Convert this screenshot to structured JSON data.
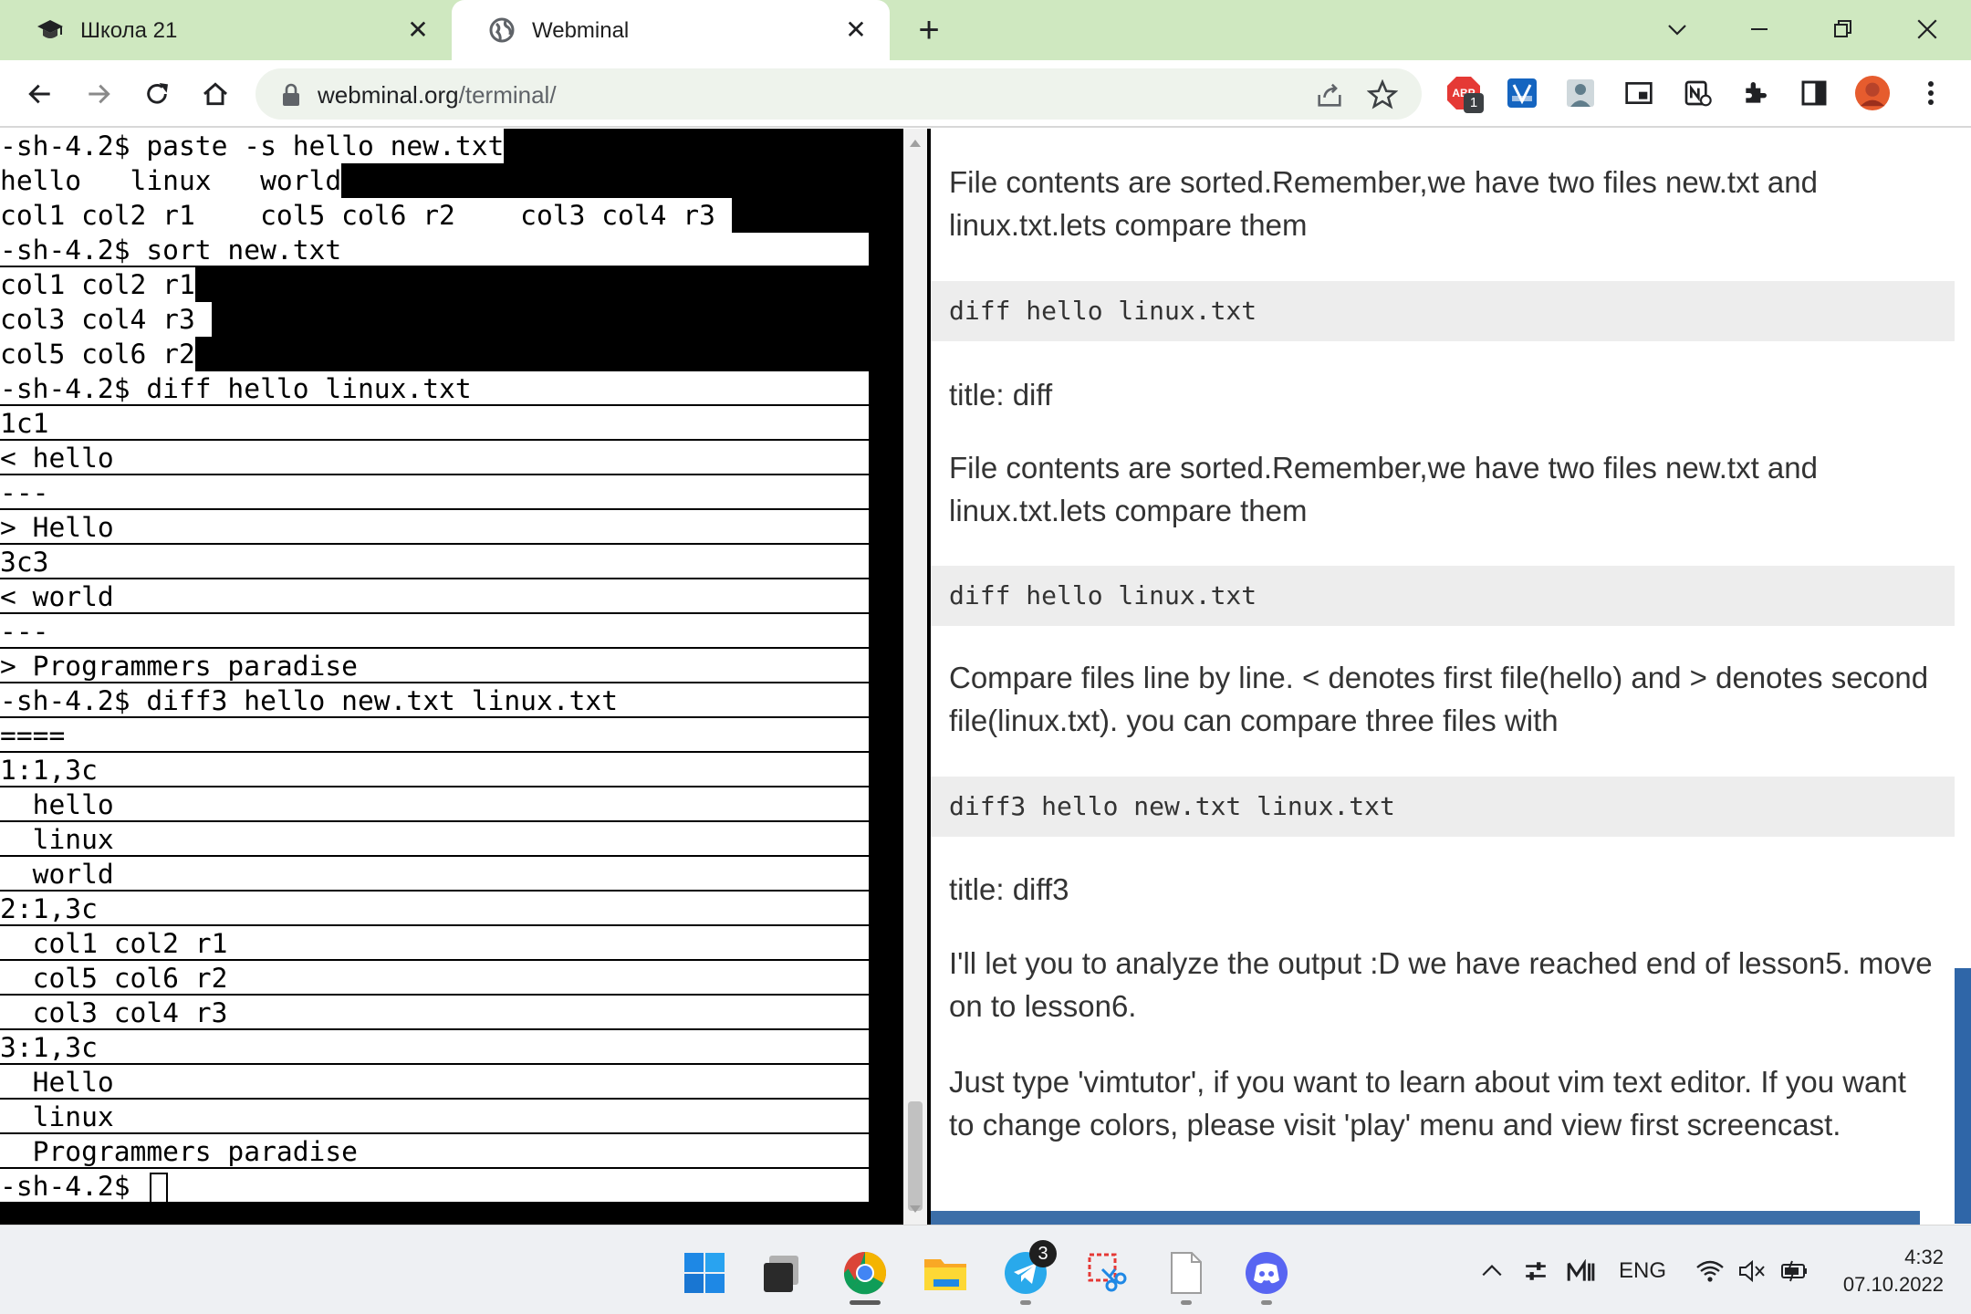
{
  "browser": {
    "tabs": [
      {
        "title": "Школа 21",
        "active": false
      },
      {
        "title": "Webminal",
        "active": true
      }
    ],
    "url": {
      "host": "webminal.org",
      "path": "/terminal/"
    },
    "extensions": {
      "abp_badge": "1"
    }
  },
  "terminal": {
    "lines": [
      "-sh-4.2$ paste -s hello new.txt",
      "hello   linux   world",
      "col1 col2 r1    col5 col6 r2    col3 col4 r3",
      "-sh-4.2$ sort new.txt",
      "col1 col2 r1",
      "col3 col4 r3",
      "col5 col6 r2",
      "-sh-4.2$ diff hello linux.txt",
      "1c1",
      "< hello",
      "---",
      "> Hello",
      "3c3",
      "< world",
      "---",
      "> Programmers paradise",
      "-sh-4.2$ diff3 hello new.txt linux.txt",
      "====",
      "1:1,3c",
      "  hello",
      "  linux",
      "  world",
      "2:1,3c",
      "  col1 col2 r1",
      "  col5 col6 r2",
      "  col3 col4 r3",
      "3:1,3c",
      "  Hello",
      "  linux",
      "  Programmers paradise"
    ],
    "prompt": "-sh-4.2$ "
  },
  "lesson": {
    "p1": "File contents are sorted.Remember,we have two files new.txt and linux.txt.lets compare them",
    "code1": "diff hello linux.txt",
    "title1": "title: diff",
    "p2": "File contents are sorted.Remember,we have two files new.txt and linux.txt.lets compare them",
    "code2": "diff hello linux.txt",
    "p3": "Compare files line by line. < denotes first file(hello) and > denotes second file(linux.txt). you can compare three files with",
    "code3": "diff3 hello new.txt linux.txt",
    "title2": "title: diff3",
    "p4": "I'll let you to analyze the output :D we have reached end of lesson5. move on to lesson6.",
    "p5": "Just type 'vimtutor', if you want to learn about vim text editor. If you want to change colors, please visit 'play' menu and view first screencast."
  },
  "taskbar": {
    "telegram_badge": "3",
    "lang": "ENG",
    "time": "4:32",
    "date": "07.10.2022"
  }
}
